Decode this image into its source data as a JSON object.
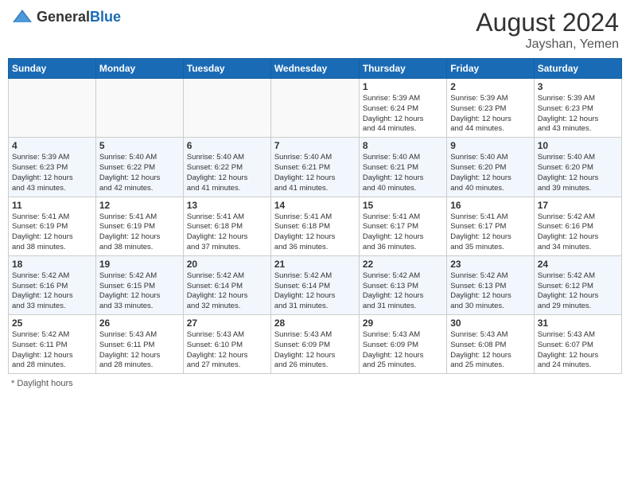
{
  "header": {
    "logo_general": "General",
    "logo_blue": "Blue",
    "month_year": "August 2024",
    "location": "Jayshan, Yemen"
  },
  "footer": {
    "note": "Daylight hours"
  },
  "days_of_week": [
    "Sunday",
    "Monday",
    "Tuesday",
    "Wednesday",
    "Thursday",
    "Friday",
    "Saturday"
  ],
  "weeks": [
    [
      {
        "day": "",
        "info": ""
      },
      {
        "day": "",
        "info": ""
      },
      {
        "day": "",
        "info": ""
      },
      {
        "day": "",
        "info": ""
      },
      {
        "day": "1",
        "info": "Sunrise: 5:39 AM\nSunset: 6:24 PM\nDaylight: 12 hours\nand 44 minutes."
      },
      {
        "day": "2",
        "info": "Sunrise: 5:39 AM\nSunset: 6:23 PM\nDaylight: 12 hours\nand 44 minutes."
      },
      {
        "day": "3",
        "info": "Sunrise: 5:39 AM\nSunset: 6:23 PM\nDaylight: 12 hours\nand 43 minutes."
      }
    ],
    [
      {
        "day": "4",
        "info": "Sunrise: 5:39 AM\nSunset: 6:23 PM\nDaylight: 12 hours\nand 43 minutes."
      },
      {
        "day": "5",
        "info": "Sunrise: 5:40 AM\nSunset: 6:22 PM\nDaylight: 12 hours\nand 42 minutes."
      },
      {
        "day": "6",
        "info": "Sunrise: 5:40 AM\nSunset: 6:22 PM\nDaylight: 12 hours\nand 41 minutes."
      },
      {
        "day": "7",
        "info": "Sunrise: 5:40 AM\nSunset: 6:21 PM\nDaylight: 12 hours\nand 41 minutes."
      },
      {
        "day": "8",
        "info": "Sunrise: 5:40 AM\nSunset: 6:21 PM\nDaylight: 12 hours\nand 40 minutes."
      },
      {
        "day": "9",
        "info": "Sunrise: 5:40 AM\nSunset: 6:20 PM\nDaylight: 12 hours\nand 40 minutes."
      },
      {
        "day": "10",
        "info": "Sunrise: 5:40 AM\nSunset: 6:20 PM\nDaylight: 12 hours\nand 39 minutes."
      }
    ],
    [
      {
        "day": "11",
        "info": "Sunrise: 5:41 AM\nSunset: 6:19 PM\nDaylight: 12 hours\nand 38 minutes."
      },
      {
        "day": "12",
        "info": "Sunrise: 5:41 AM\nSunset: 6:19 PM\nDaylight: 12 hours\nand 38 minutes."
      },
      {
        "day": "13",
        "info": "Sunrise: 5:41 AM\nSunset: 6:18 PM\nDaylight: 12 hours\nand 37 minutes."
      },
      {
        "day": "14",
        "info": "Sunrise: 5:41 AM\nSunset: 6:18 PM\nDaylight: 12 hours\nand 36 minutes."
      },
      {
        "day": "15",
        "info": "Sunrise: 5:41 AM\nSunset: 6:17 PM\nDaylight: 12 hours\nand 36 minutes."
      },
      {
        "day": "16",
        "info": "Sunrise: 5:41 AM\nSunset: 6:17 PM\nDaylight: 12 hours\nand 35 minutes."
      },
      {
        "day": "17",
        "info": "Sunrise: 5:42 AM\nSunset: 6:16 PM\nDaylight: 12 hours\nand 34 minutes."
      }
    ],
    [
      {
        "day": "18",
        "info": "Sunrise: 5:42 AM\nSunset: 6:16 PM\nDaylight: 12 hours\nand 33 minutes."
      },
      {
        "day": "19",
        "info": "Sunrise: 5:42 AM\nSunset: 6:15 PM\nDaylight: 12 hours\nand 33 minutes."
      },
      {
        "day": "20",
        "info": "Sunrise: 5:42 AM\nSunset: 6:14 PM\nDaylight: 12 hours\nand 32 minutes."
      },
      {
        "day": "21",
        "info": "Sunrise: 5:42 AM\nSunset: 6:14 PM\nDaylight: 12 hours\nand 31 minutes."
      },
      {
        "day": "22",
        "info": "Sunrise: 5:42 AM\nSunset: 6:13 PM\nDaylight: 12 hours\nand 31 minutes."
      },
      {
        "day": "23",
        "info": "Sunrise: 5:42 AM\nSunset: 6:13 PM\nDaylight: 12 hours\nand 30 minutes."
      },
      {
        "day": "24",
        "info": "Sunrise: 5:42 AM\nSunset: 6:12 PM\nDaylight: 12 hours\nand 29 minutes."
      }
    ],
    [
      {
        "day": "25",
        "info": "Sunrise: 5:42 AM\nSunset: 6:11 PM\nDaylight: 12 hours\nand 28 minutes."
      },
      {
        "day": "26",
        "info": "Sunrise: 5:43 AM\nSunset: 6:11 PM\nDaylight: 12 hours\nand 28 minutes."
      },
      {
        "day": "27",
        "info": "Sunrise: 5:43 AM\nSunset: 6:10 PM\nDaylight: 12 hours\nand 27 minutes."
      },
      {
        "day": "28",
        "info": "Sunrise: 5:43 AM\nSunset: 6:09 PM\nDaylight: 12 hours\nand 26 minutes."
      },
      {
        "day": "29",
        "info": "Sunrise: 5:43 AM\nSunset: 6:09 PM\nDaylight: 12 hours\nand 25 minutes."
      },
      {
        "day": "30",
        "info": "Sunrise: 5:43 AM\nSunset: 6:08 PM\nDaylight: 12 hours\nand 25 minutes."
      },
      {
        "day": "31",
        "info": "Sunrise: 5:43 AM\nSunset: 6:07 PM\nDaylight: 12 hours\nand 24 minutes."
      }
    ]
  ]
}
